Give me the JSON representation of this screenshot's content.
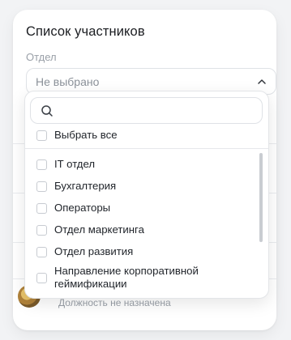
{
  "panel": {
    "title": "Список участников",
    "department_label": "Отдел",
    "department_select_value": "Не выбрано"
  },
  "dropdown": {
    "search_placeholder": "",
    "select_all_label": "Выбрать все",
    "options": [
      {
        "label": "IT отдел",
        "checked": false
      },
      {
        "label": "Бухгалтерия",
        "checked": false
      },
      {
        "label": "Операторы",
        "checked": false
      },
      {
        "label": "Отдел маркетинга",
        "checked": false
      },
      {
        "label": "Отдел развития",
        "checked": false
      },
      {
        "label": "Направление корпоративной\nгеймификации",
        "checked": false
      }
    ]
  },
  "background_row": {
    "position_text": "Должность не назначена"
  },
  "icons": {
    "chevron": "chevron-up-icon",
    "search": "search-icon"
  },
  "colors": {
    "border": "#dfe2e6",
    "muted_text": "#9aa0a8",
    "text": "#1f2329"
  }
}
